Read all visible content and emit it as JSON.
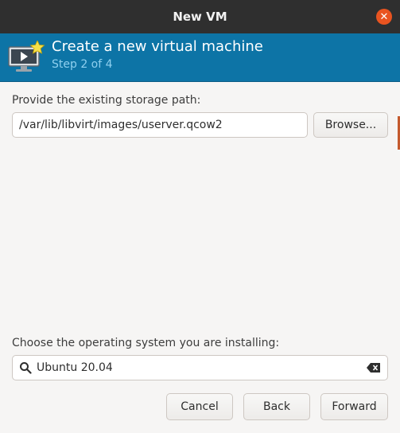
{
  "window": {
    "title": "New VM",
    "close_icon": "close-icon"
  },
  "header": {
    "title": "Create a new virtual machine",
    "step": "Step 2 of 4",
    "icon": "new-vm-icon",
    "background": "#0d74a6"
  },
  "storage": {
    "label": "Provide the existing storage path:",
    "path_value": "/var/lib/libvirt/images/userver.qcow2",
    "browse_label": "Browse..."
  },
  "os": {
    "label": "Choose the operating system you are installing:",
    "search_value": "Ubuntu 20.04",
    "search_icon": "search-icon",
    "clear_icon": "clear-text-icon"
  },
  "footer": {
    "cancel_label": "Cancel",
    "back_label": "Back",
    "forward_label": "Forward"
  },
  "colors": {
    "accent": "#e95420",
    "titlebar": "#2f2f2f"
  }
}
